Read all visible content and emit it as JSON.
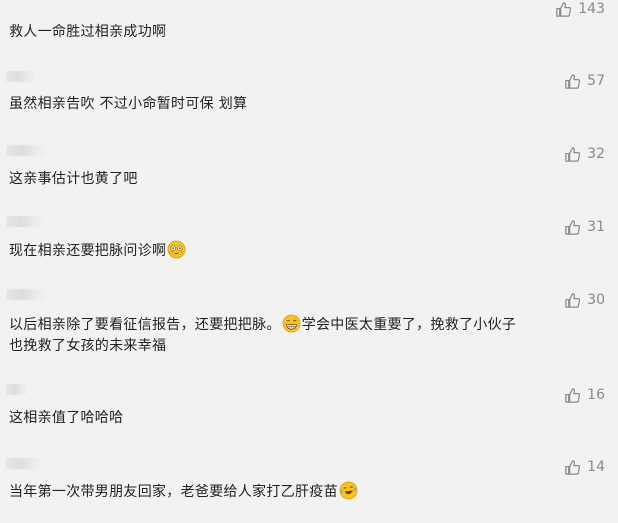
{
  "comments": [
    {
      "likes": "143",
      "text": "救人一命胜过相亲成功啊"
    },
    {
      "likes": "57",
      "text": "虽然相亲告吹 不过小命暂时可保 划算"
    },
    {
      "likes": "32",
      "text": "这亲事估计也黄了吧"
    },
    {
      "likes": "31",
      "text": "现在相亲还要把脉问诊啊",
      "emoji_after": "flushed-emoji"
    },
    {
      "likes": "30",
      "text_part1": "以后相亲除了要看征信报告，还要把把脉。",
      "emoji_mid": "grin-emoji",
      "text_part2": "学会中医太重要了，挽救了小伙子",
      "text_line2": "也挽救了女孩的未来幸福"
    },
    {
      "likes": "16",
      "text": "这相亲值了哈哈哈"
    },
    {
      "likes": "14",
      "text": "当年第一次带男朋友回家，老爸要给人家打乙肝疫苗",
      "emoji_after": "cry-laugh-emoji"
    }
  ],
  "colors": {
    "background": "#f2f2f2",
    "text": "#222222",
    "like": "#8a8a8a",
    "emoji": "#f6c21c"
  }
}
